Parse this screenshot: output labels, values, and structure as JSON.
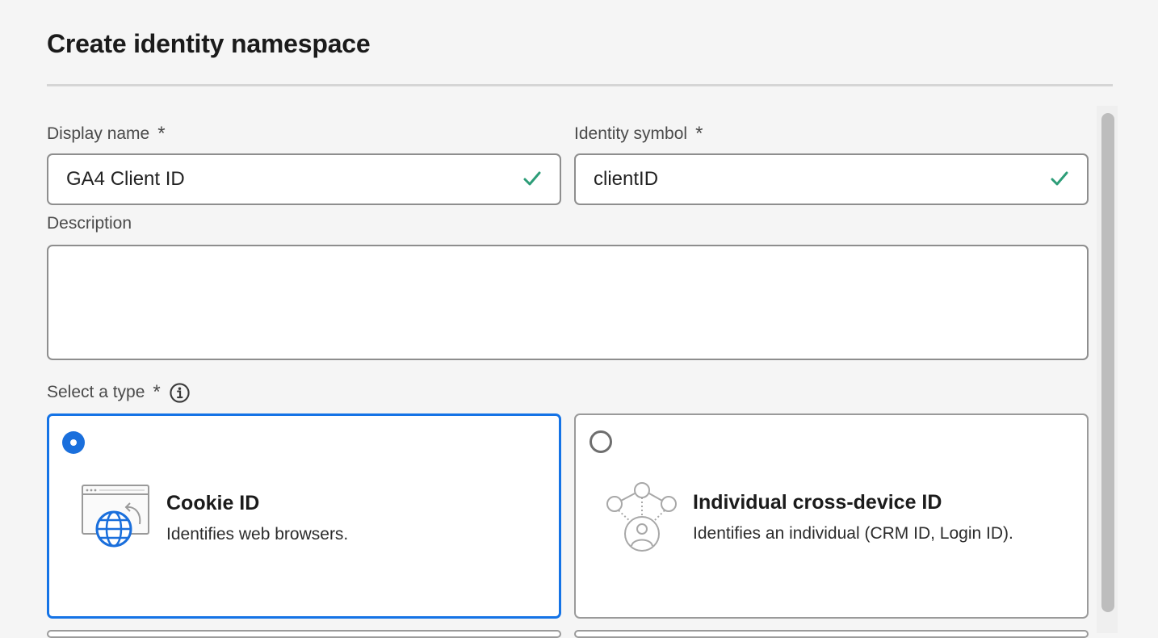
{
  "dialog": {
    "title": "Create identity namespace"
  },
  "display_name": {
    "label": "Display name",
    "required_marker": "*",
    "value": "GA4 Client ID",
    "valid": true
  },
  "identity_symbol": {
    "label": "Identity symbol",
    "required_marker": "*",
    "value": "clientID",
    "valid": true
  },
  "description": {
    "label": "Description",
    "value": ""
  },
  "type_select": {
    "label": "Select a type",
    "required_marker": "*",
    "info_icon": "info-icon",
    "options": [
      {
        "title": "Cookie ID",
        "description": "Identifies web browsers.",
        "icon": "cookie-browser-globe-icon",
        "selected": true
      },
      {
        "title": "Individual cross-device ID",
        "description": "Identifies an individual (CRM ID, Login ID).",
        "icon": "cross-device-person-icon",
        "selected": false
      }
    ]
  },
  "colors": {
    "accent": "#1473e6",
    "valid_check": "#2d9d78",
    "field_border": "#8e8e8e",
    "background": "#f5f5f5"
  }
}
